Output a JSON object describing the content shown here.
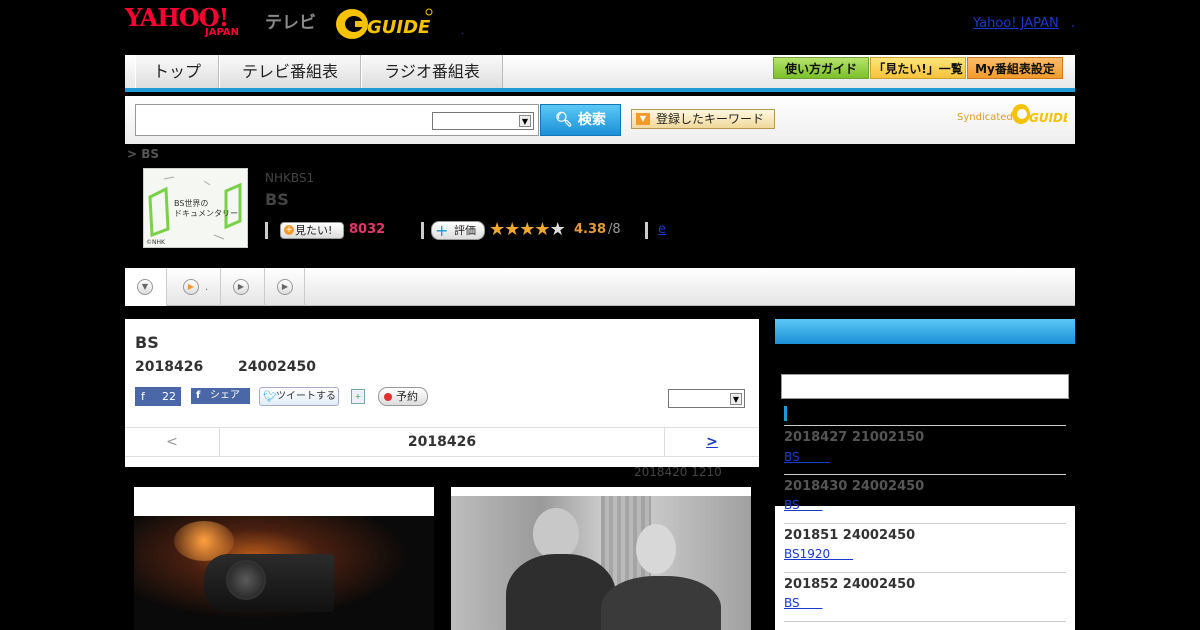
{
  "header": {
    "logo_yahoo": "YAHOO!",
    "logo_japan": "JAPAN",
    "logo_tv": "テレビ",
    "logo_gguide": "G-GUIDE",
    "yahoo_japan_link": "Yahoo! JAPAN",
    "dot_mark": "."
  },
  "nav": {
    "tabs": [
      "トップ",
      "テレビ番組表",
      "ラジオ番組表"
    ],
    "guide_buttons": [
      "使い方ガイド",
      "「見たい!」一覧",
      "My番組表設定"
    ]
  },
  "search": {
    "placeholder": "",
    "button_label": "検索",
    "keyword_button": "登録したキーワード",
    "syndicated_label": "Syndicated"
  },
  "breadcrumb": "> BS",
  "program": {
    "thumb_text": "BS世界の\nドキュメンタリー",
    "thumb_nhk": "©NHK",
    "channel": "NHKBS1",
    "title": "BS",
    "miru_label": "見たい!",
    "miru_count": "8032",
    "hyoka_label": "評価",
    "stars_filled": 4,
    "stars_total": 5,
    "rating": "4.38",
    "rating_max": "/8",
    "extra_link": "e"
  },
  "main": {
    "title": "BS",
    "date": "2018426",
    "time": "24002450",
    "fb_like_count": "22",
    "fb_share_label": "シェア",
    "tweet_label": "ツイートする",
    "reserve_label": "予約",
    "prev_label": "<",
    "current_date": "2018426",
    "next_label": ">",
    "update_note": "2018420  1210"
  },
  "sidebar": {
    "episodes": [
      {
        "date": "2018427  21002150",
        "link": "BS        "
      },
      {
        "date": "2018430  24002450",
        "link": "BS      "
      },
      {
        "date": "201851  24002450",
        "link": "BS1920      "
      },
      {
        "date": "201852  24002450",
        "link": "BS      "
      }
    ]
  },
  "colors": {
    "accent_blue": "#1f9ad6",
    "miru_pink": "#e5376b",
    "star_orange": "#f0a830"
  }
}
